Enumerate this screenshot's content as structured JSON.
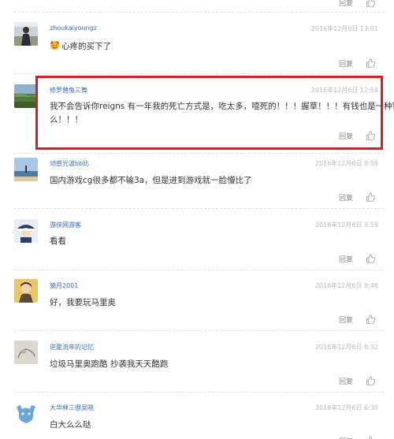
{
  "actions": {
    "reply_label": "回复"
  },
  "comments": [
    {
      "username": "zhoukaiyoungz",
      "time": "2016年12月6日 13:01",
      "content": "心疼的买下了",
      "avatar": "avatar-person-outdoor"
    },
    {
      "username": "修罗替兔三舞",
      "time": "2016年12月6日 12:54",
      "content_line1": "我不会告诉你reigns 有一年我的死亡方式是，吃太多，噎死的！！！握草！！！有钱也是一种错",
      "content_line2": "么！！！",
      "avatar": "avatar-landscape"
    },
    {
      "username": "动感光波bb比",
      "time": "2016年12月6日 9:59",
      "content": "国内游戏cg很多都不输3a，但是进到游戏就一脸懵比了",
      "avatar": "avatar-beach"
    },
    {
      "username": "游侠网游客",
      "time": "2016年12月6日 9:59",
      "content": "看看",
      "avatar": "avatar-cartoon"
    },
    {
      "username": "猿月2001",
      "time": "2016年12月6日 8:46",
      "content": "好，我要玩马里奥",
      "avatar": "avatar-person-yellow"
    },
    {
      "username": "逆夏流年的记忆",
      "time": "2016年12月6日 8:32",
      "content": "垃圾马里奥跑酷 抄袭我天天酷跑",
      "avatar": "avatar-sketch"
    },
    {
      "username": "大华林三很吴晓",
      "time": "2016年12月6日 6:30",
      "content": "白大么么哒",
      "avatar": "avatar-bear"
    }
  ]
}
